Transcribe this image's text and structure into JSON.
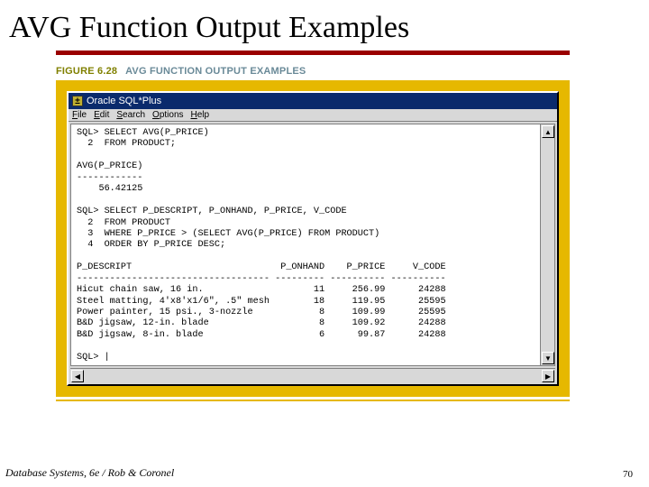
{
  "slide": {
    "title": "AVG Function Output Examples"
  },
  "figure": {
    "number": "FIGURE 6.28",
    "caption": "AVG FUNCTION OUTPUT EXAMPLES"
  },
  "window": {
    "title": "Oracle SQL*Plus",
    "menu": {
      "file": "File",
      "edit": "Edit",
      "search": "Search",
      "options": "Options",
      "help": "Help"
    }
  },
  "sql_output": "SQL> SELECT AVG(P_PRICE)\n  2  FROM PRODUCT;\n\nAVG(P_PRICE)\n------------\n    56.42125\n\nSQL> SELECT P_DESCRIPT, P_ONHAND, P_PRICE, V_CODE\n  2  FROM PRODUCT\n  3  WHERE P_PRICE > (SELECT AVG(P_PRICE) FROM PRODUCT)\n  4  ORDER BY P_PRICE DESC;\n\nP_DESCRIPT                           P_ONHAND    P_PRICE     V_CODE\n----------------------------------- --------- ---------- ----------\nHicut chain saw, 16 in.                    11     256.99      24288\nSteel matting, 4'x8'x1/6\", .5\" mesh        18     119.95      25595\nPower painter, 15 psi., 3-nozzle            8     109.99      25595\nB&D jigsaw, 12-in. blade                    8     109.92      24288\nB&D jigsaw, 8-in. blade                     6      99.87      24288\n\nSQL> |",
  "footer": {
    "text": "Database Systems, 6e / Rob & Coronel",
    "page": "70"
  }
}
